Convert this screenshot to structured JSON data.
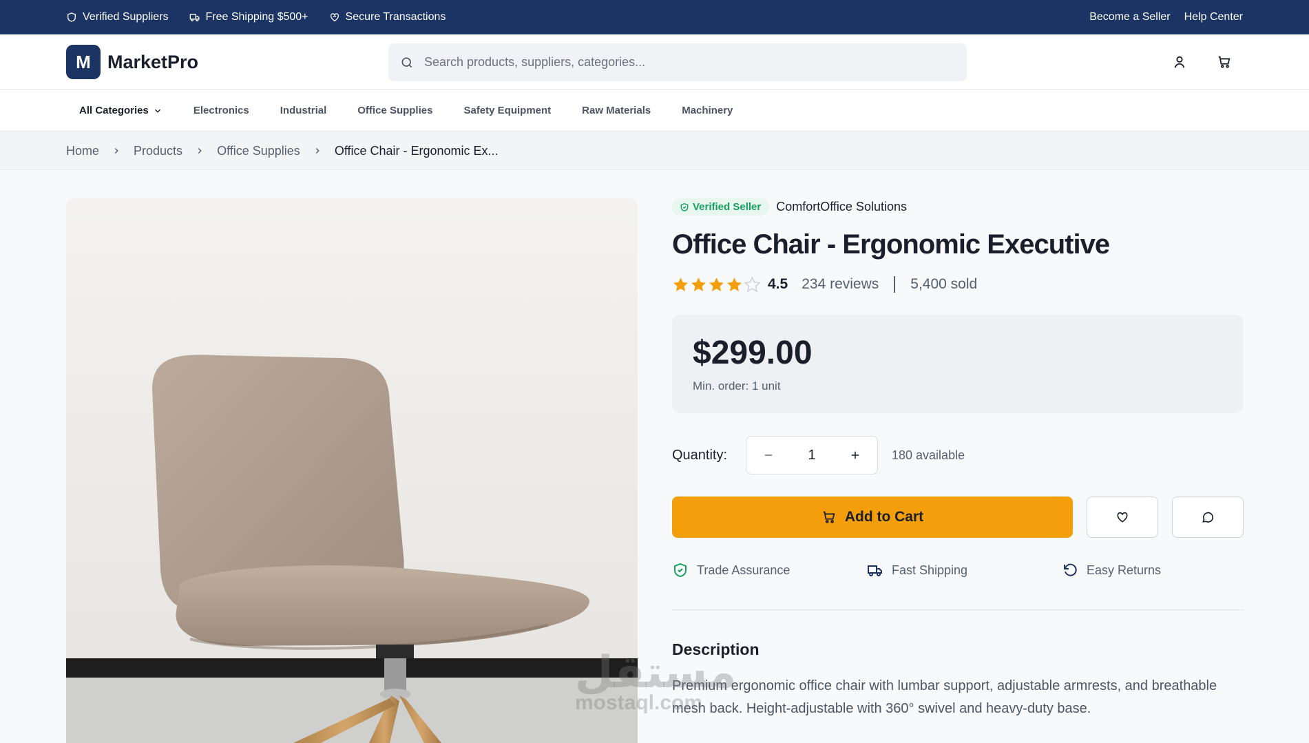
{
  "topbar": {
    "badges": [
      "Verified Suppliers",
      "Free Shipping $500+",
      "Secure Transactions"
    ],
    "become_seller": "Become a Seller",
    "help_center": "Help Center"
  },
  "header": {
    "logo_letter": "M",
    "brand": "MarketPro",
    "search_placeholder": "Search products, suppliers, categories..."
  },
  "nav": {
    "all_categories": "All Categories",
    "categories": [
      "Electronics",
      "Industrial",
      "Office Supplies",
      "Safety Equipment",
      "Raw Materials",
      "Machinery"
    ]
  },
  "breadcrumb": [
    "Home",
    "Products",
    "Office Supplies",
    "Office Chair - Ergonomic Ex..."
  ],
  "product": {
    "verified_label": "Verified Seller",
    "seller": "ComfortOffice Solutions",
    "title": "Office Chair - Ergonomic Executive",
    "rating": "4.5",
    "rating_value": 4.5,
    "reviews": "234 reviews",
    "sold": "5,400 sold",
    "price": "$299.00",
    "min_order": "Min. order: 1 unit",
    "quantity_label": "Quantity:",
    "quantity": "1",
    "available": "180 available",
    "add_to_cart": "Add to Cart",
    "features": [
      "Trade Assurance",
      "Fast Shipping",
      "Easy Returns"
    ],
    "description_title": "Description",
    "description": "Premium ergonomic office chair with lumbar support, adjustable armrests, and breathable mesh back. Height-adjustable with 360° swivel and heavy-duty base."
  },
  "watermark": {
    "arabic": "مستقل",
    "latin": "mostaql.com"
  },
  "colors": {
    "navy": "#1b3464",
    "accent": "#f59e0b",
    "verified_green": "#16a05d",
    "star": "#f59e0b"
  }
}
